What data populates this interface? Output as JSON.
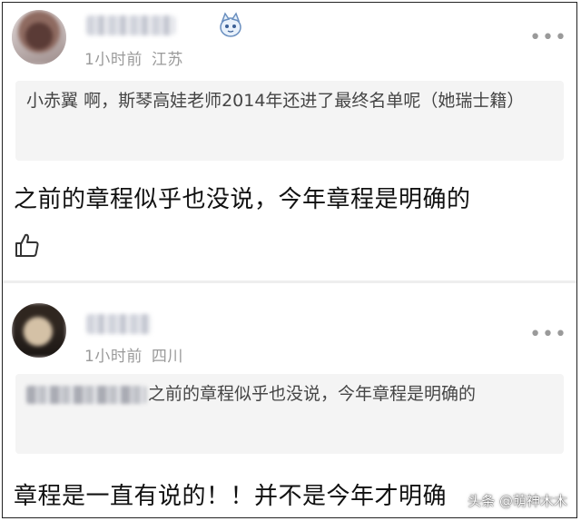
{
  "comments": [
    {
      "time": "1小时前",
      "location": "江苏",
      "badge_icon": "cat-mascot-icon",
      "quote_author": "小赤翼",
      "quote_text": "啊，斯琴高娃老师2014年还进了最终名单呢（她瑞士籍）",
      "body": "之前的章程似乎也没说，今年章程是明确的",
      "like_icon": "thumbs-up-icon"
    },
    {
      "time": "1小时前",
      "location": "四川",
      "quote_text": "之前的章程似乎也没说，今年章程是明确的",
      "body": "章程是一直有说的！！并不是今年才明确"
    }
  ],
  "more_label": "•••",
  "watermark": "头条 @萌神木木"
}
